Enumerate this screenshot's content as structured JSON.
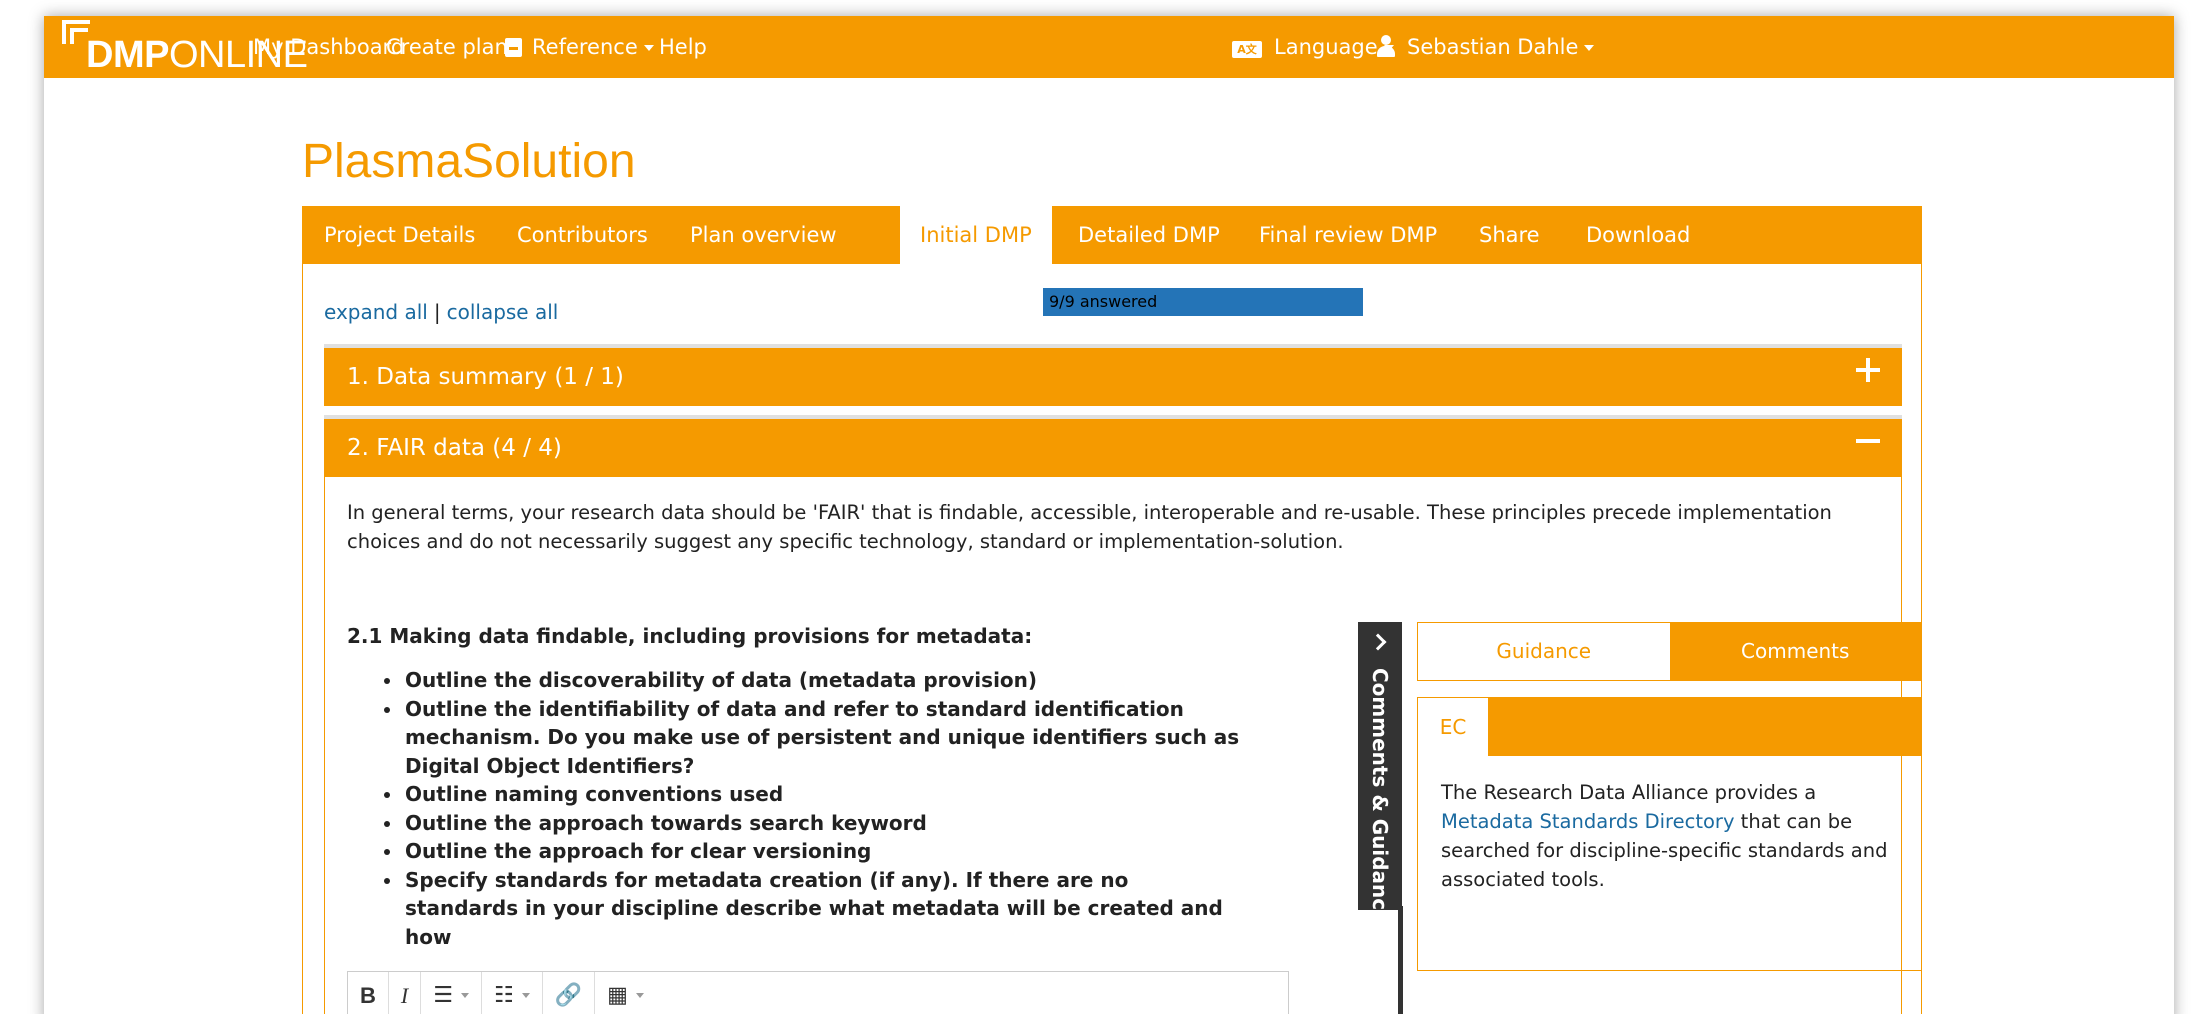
{
  "nav": {
    "logo_bold": "DMP",
    "logo_light": "ONLINE",
    "links": [
      "My Dashboard",
      "Create plans"
    ],
    "reference": "Reference",
    "help": "Help",
    "lang_icon_text": "A文",
    "language": "Language",
    "user": "Sebastian Dahle"
  },
  "plan": {
    "title": "PlasmaSolution",
    "tabs": [
      "Project Details",
      "Contributors",
      "Plan overview",
      "Initial DMP",
      "Detailed DMP",
      "Final review DMP",
      "Share",
      "Download"
    ],
    "active_tab": "Initial DMP"
  },
  "controls": {
    "expand_all": "expand all",
    "separator": "|",
    "collapse_all": "collapse all",
    "progress_label": "9/9 answered",
    "progress_fraction": 1.0
  },
  "sections": [
    {
      "title": "1. Data summary (1 / 1)",
      "state": "collapsed"
    },
    {
      "title": "2. FAIR data (4 / 4)",
      "state": "expanded"
    }
  ],
  "fair": {
    "intro": "In general terms, your research data should be 'FAIR' that is findable, accessible, interoperable and re-usable. These principles precede implementation choices and do not necessarily suggest any specific technology, standard or implementation-solution.",
    "question_title": "2.1 Making data findable, including provisions for metadata:",
    "bullets": [
      "Outline the discoverability of data (metadata provision)",
      "Outline the identifiability of data and refer to standard identification mechanism. Do you make use of persistent and unique identifiers such as Digital Object Identifiers?",
      "Outline naming conventions used",
      "Outline the approach towards search keyword",
      "Outline the approach for clear versioning",
      "Specify standards for metadata creation (if any). If there are no standards in your discipline describe what metadata will be created and how"
    ]
  },
  "editor": {
    "bold": "B",
    "italic": "I",
    "bullet_list": "☰",
    "numbered_list": "☷",
    "link": "🔗",
    "table": "▦"
  },
  "sidepanel": {
    "toggle_label": "Comments & Guidance",
    "tabs": [
      "Guidance",
      "Comments"
    ],
    "org_tab": "EC",
    "guidance_before": "The Research Data Alliance provides a ",
    "guidance_link": "Metadata Standards Directory",
    "guidance_after": " that can be searched for discipline-specific standards and associated tools."
  },
  "colors": {
    "brand_orange": "#f59a00",
    "link_blue": "#1a6aa0",
    "progress_blue": "#2474b7",
    "side_tab_dark": "#333333"
  }
}
